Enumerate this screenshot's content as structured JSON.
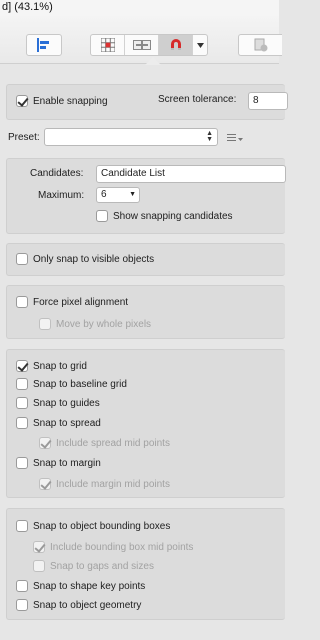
{
  "titlebar": {
    "text": "d] (43.1%)"
  },
  "toolbar": {
    "icons": [
      "align-left-icon",
      "grid-icon",
      "spread-icon",
      "magnet-icon",
      "dropdown-icon",
      "document-icon"
    ]
  },
  "snapping": {
    "enable_label": "Enable snapping",
    "enable_checked": true,
    "tolerance_label": "Screen tolerance:",
    "tolerance_value": "8",
    "preset_label": "Preset:",
    "preset_value": "",
    "candidates_label": "Candidates:",
    "candidates_value": "Candidate List",
    "maximum_label": "Maximum:",
    "maximum_value": "6",
    "show_candidates_label": "Show snapping candidates",
    "visible_only_label": "Only snap to visible objects",
    "force_pixel_label": "Force pixel alignment",
    "move_whole_label": "Move by whole pixels",
    "grid_group": {
      "snap_grid": "Snap to grid",
      "snap_baseline": "Snap to baseline grid",
      "snap_guides": "Snap to guides",
      "snap_spread": "Snap to spread",
      "spread_mid": "Include spread mid points",
      "snap_margin": "Snap to margin",
      "margin_mid": "Include margin mid points"
    },
    "object_group": {
      "bounding": "Snap to object bounding boxes",
      "bbox_mid": "Include bounding box mid points",
      "gaps": "Snap to gaps and sizes",
      "shape_key": "Snap to shape key points",
      "geometry": "Snap to object geometry"
    }
  }
}
